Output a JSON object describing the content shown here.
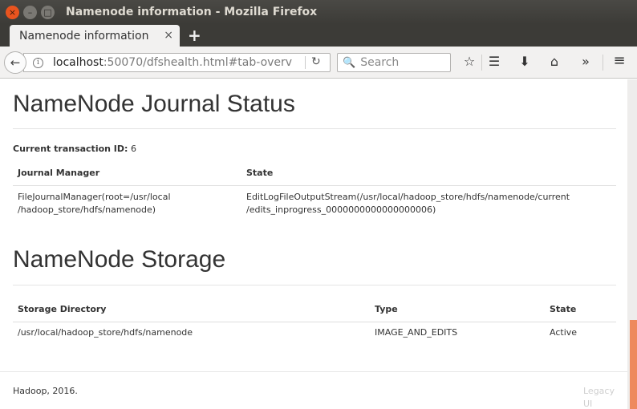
{
  "window": {
    "title": "Namenode information - Mozilla Firefox",
    "close_glyph": "×",
    "min_glyph": "–",
    "max_glyph": "□"
  },
  "tabs": {
    "active_label": "Namenode information",
    "close_glyph": "×",
    "new_tab_glyph": "+"
  },
  "navbar": {
    "back_glyph": "←",
    "info_glyph": "i",
    "url_host": "localhost",
    "url_path": ":50070/dfshealth.html#tab-overv",
    "reload_glyph": "↻",
    "search_glyph": "🔍",
    "search_placeholder": "Search",
    "bookmark_glyph": "☆",
    "reader_glyph": "☰",
    "download_glyph": "⬇",
    "home_glyph": "⌂",
    "overflow_glyph": "»",
    "menu_glyph": "≡",
    "icons": [
      "info-icon",
      "reload-icon",
      "search-icon",
      "bookmark-star-icon",
      "reading-list-icon",
      "download-icon",
      "home-icon",
      "overflow-icon",
      "hamburger-menu-icon"
    ]
  },
  "journal": {
    "heading": "NameNode Journal Status",
    "txid_label": "Current transaction ID:",
    "txid_value": "6",
    "headers": [
      "Journal Manager",
      "State"
    ],
    "rows": [
      {
        "manager_line1": "FileJournalManager(root=/usr/local",
        "manager_line2": "/hadoop_store/hdfs/namenode)",
        "state_line1": "EditLogFileOutputStream(/usr/local/hadoop_store/hdfs/namenode/current",
        "state_line2": "/edits_inprogress_0000000000000000006)"
      }
    ]
  },
  "storage": {
    "heading": "NameNode Storage",
    "headers": [
      "Storage Directory",
      "Type",
      "State"
    ],
    "rows": [
      {
        "directory": "/usr/local/hadoop_store/hdfs/namenode",
        "type": "IMAGE_AND_EDITS",
        "state": "Active"
      }
    ]
  },
  "footer": {
    "text": "Hadoop, 2016.",
    "legacy_line1": "Legacy",
    "legacy_line2": "UI"
  },
  "colors": {
    "close_button": "#e9541f",
    "titlebar": "#3c3b37",
    "scroll_thumb": "#ee8a5e"
  }
}
